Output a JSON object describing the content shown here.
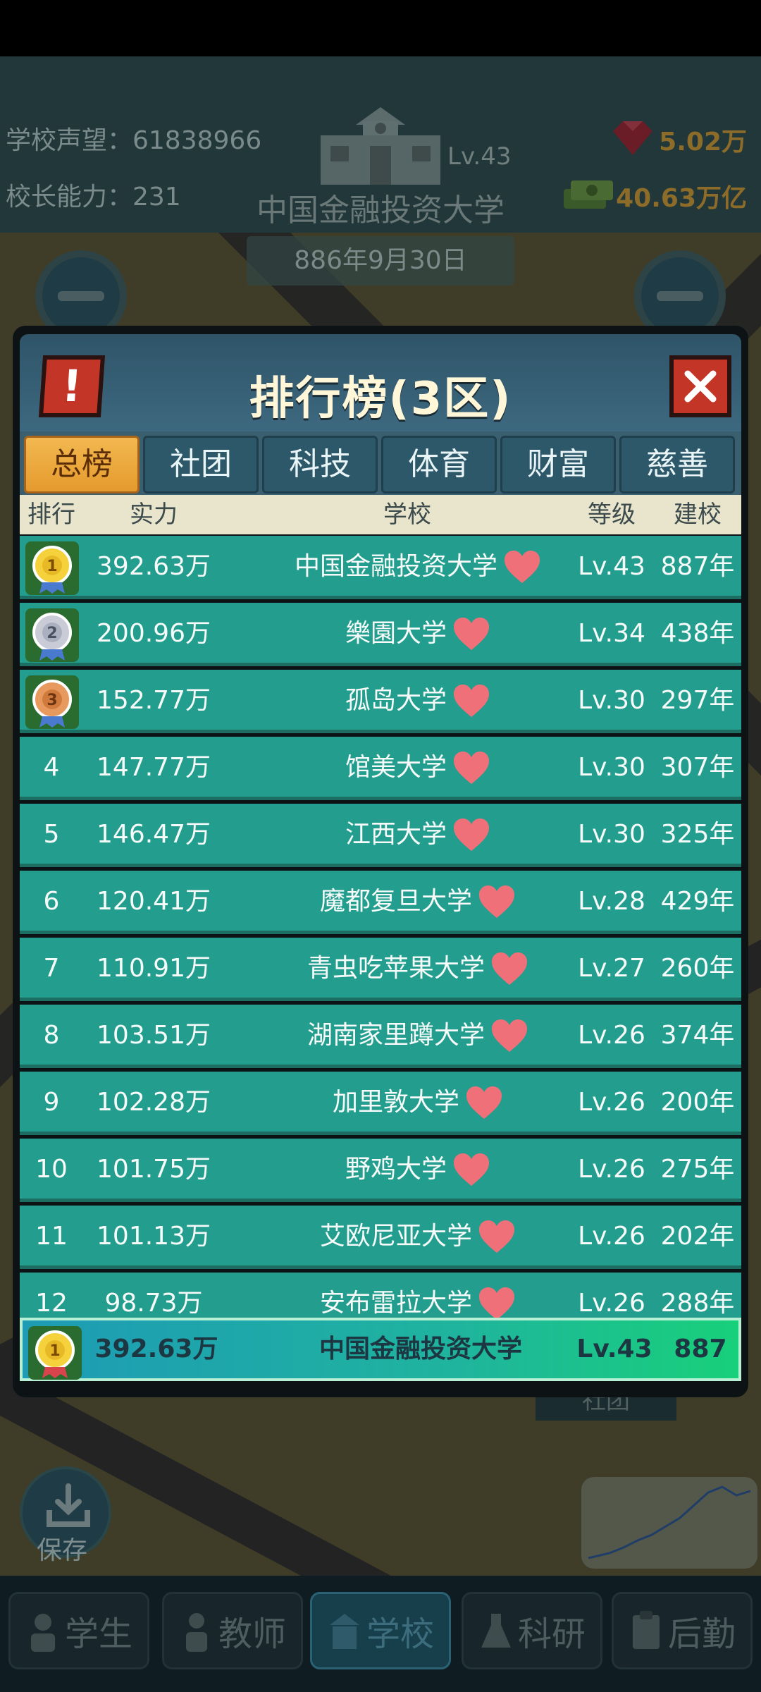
{
  "hud": {
    "reputation": "学校声望：61838966",
    "principal_ability": "校长能力：231",
    "school_level": "Lv.43",
    "school_name": "中国金融投资大学",
    "date": "886年9月30日",
    "gems": "5.02万",
    "cash": "40.63万亿"
  },
  "modal": {
    "title": "排行榜(3区)",
    "info_label": "!",
    "tabs": [
      "总榜",
      "社团",
      "科技",
      "体育",
      "财富",
      "慈善"
    ],
    "active_tab": "总榜",
    "columns": {
      "rank": "排行",
      "power": "实力",
      "school": "学校",
      "level": "等级",
      "founded": "建校"
    },
    "rows": [
      {
        "rank": "1",
        "power": "392.63万",
        "school": "中国金融投资大学",
        "level": "Lv.43",
        "founded": "887年",
        "medal": "gold"
      },
      {
        "rank": "2",
        "power": "200.96万",
        "school": "樂園大学",
        "level": "Lv.34",
        "founded": "438年",
        "medal": "silver"
      },
      {
        "rank": "3",
        "power": "152.77万",
        "school": "孤岛大学",
        "level": "Lv.30",
        "founded": "297年",
        "medal": "bronze"
      },
      {
        "rank": "4",
        "power": "147.77万",
        "school": "馆美大学",
        "level": "Lv.30",
        "founded": "307年"
      },
      {
        "rank": "5",
        "power": "146.47万",
        "school": "江西大学",
        "level": "Lv.30",
        "founded": "325年"
      },
      {
        "rank": "6",
        "power": "120.41万",
        "school": "魔都复旦大学",
        "level": "Lv.28",
        "founded": "429年"
      },
      {
        "rank": "7",
        "power": "110.91万",
        "school": "青虫吃苹果大学",
        "level": "Lv.27",
        "founded": "260年"
      },
      {
        "rank": "8",
        "power": "103.51万",
        "school": "湖南家里蹲大学",
        "level": "Lv.26",
        "founded": "374年"
      },
      {
        "rank": "9",
        "power": "102.28万",
        "school": "加里敦大学",
        "level": "Lv.26",
        "founded": "200年"
      },
      {
        "rank": "10",
        "power": "101.75万",
        "school": "野鸡大学",
        "level": "Lv.26",
        "founded": "275年"
      },
      {
        "rank": "11",
        "power": "101.13万",
        "school": "艾欧尼亚大学",
        "level": "Lv.26",
        "founded": "202年"
      },
      {
        "rank": "12",
        "power": "98.73万",
        "school": "安布雷拉大学",
        "level": "Lv.26",
        "founded": "288年"
      }
    ],
    "my_row": {
      "power": "392.63万",
      "school": "中国金融投资大学",
      "level": "Lv.43",
      "founded": "887",
      "medal": "gold"
    }
  },
  "bottom": {
    "save_label": "保存",
    "club_label": "社团",
    "nav": [
      "学生",
      "教师",
      "学校",
      "科研",
      "后勤"
    ],
    "active_nav": "学校"
  },
  "colors": {
    "row": "#239e8e",
    "tab_active": "#f2b850",
    "close": "#c33627",
    "heart": "#f0707a"
  }
}
